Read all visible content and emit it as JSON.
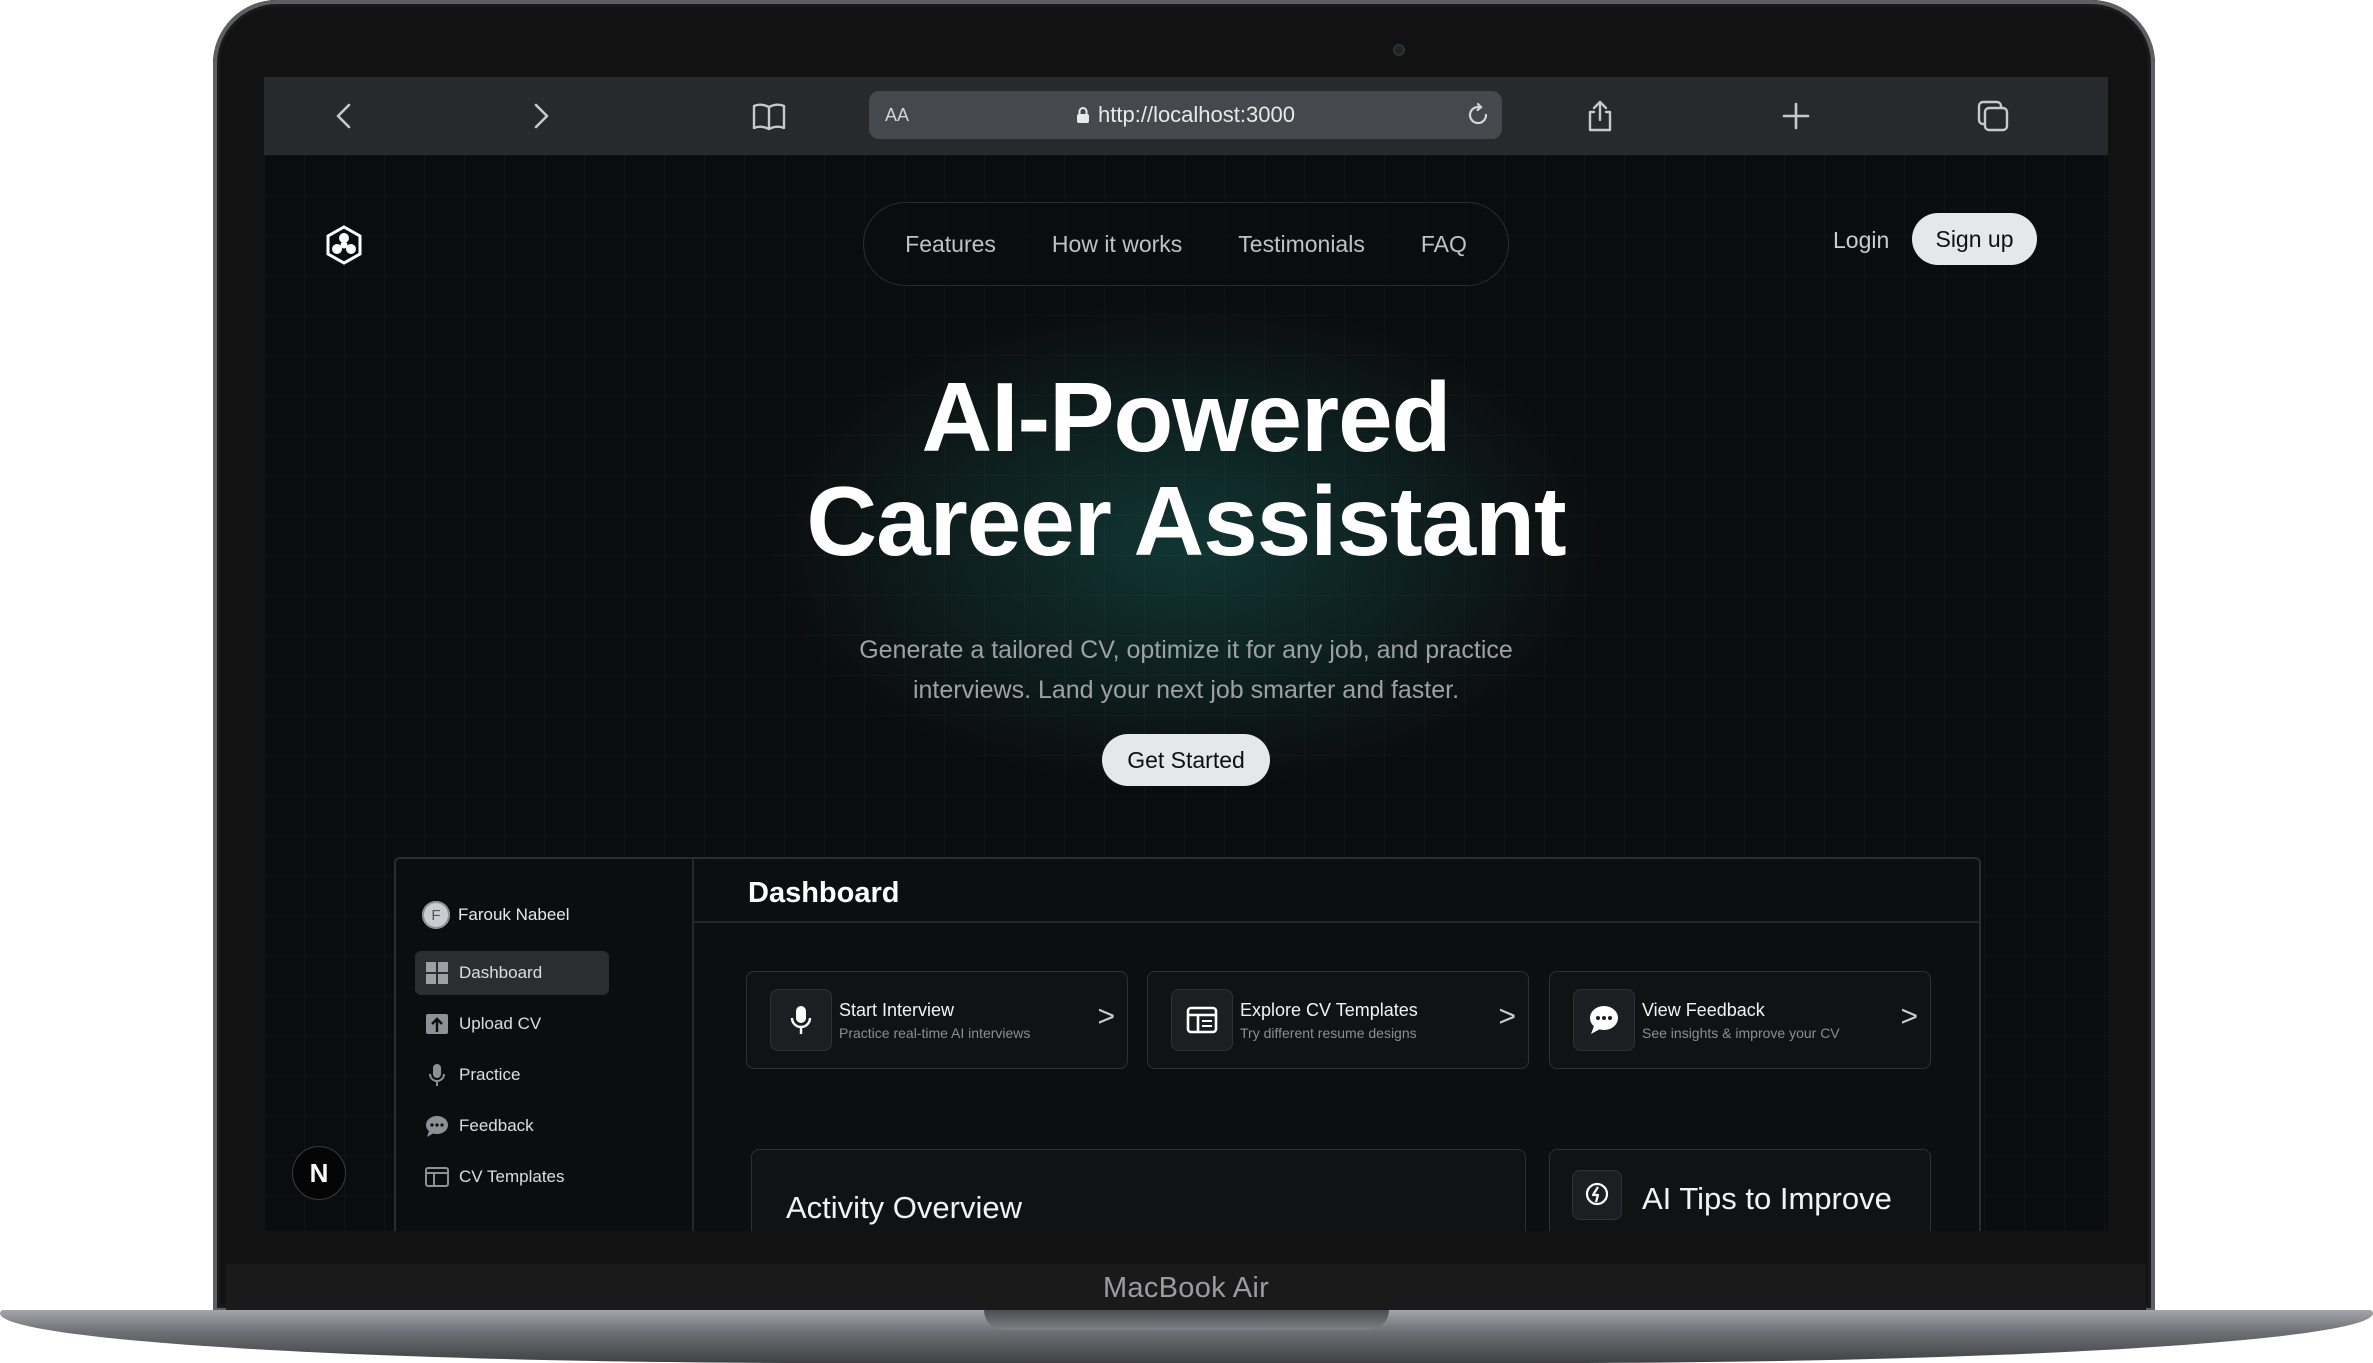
{
  "device": {
    "label": "MacBook Air"
  },
  "browser": {
    "url_aa": "AA",
    "url": "http://localhost:3000",
    "icons": [
      "back-icon",
      "forward-icon",
      "bookmarks-icon",
      "lock-icon",
      "reload-icon",
      "share-icon",
      "new-tab-icon",
      "tabs-icon"
    ]
  },
  "nav": {
    "links": [
      "Features",
      "How it works",
      "Testimonials",
      "FAQ"
    ],
    "login": "Login",
    "signup": "Sign up"
  },
  "hero": {
    "title_line1": "AI-Powered",
    "title_line2": "Career Assistant",
    "subtitle_line1": "Generate a tailored CV, optimize it for any job, and practice",
    "subtitle_line2": "interviews. Land your next job smarter and faster.",
    "cta": "Get Started"
  },
  "dashboard": {
    "user": {
      "initial": "F",
      "name": "Farouk Nabeel"
    },
    "sidebar": [
      {
        "label": "Dashboard",
        "icon": "grid-icon",
        "active": true
      },
      {
        "label": "Upload CV",
        "icon": "upload-icon",
        "active": false
      },
      {
        "label": "Practice",
        "icon": "microphone-icon",
        "active": false
      },
      {
        "label": "Feedback",
        "icon": "chat-bubble-icon",
        "active": false
      },
      {
        "label": "CV Templates",
        "icon": "template-icon",
        "active": false
      }
    ],
    "title": "Dashboard",
    "cards": [
      {
        "title": "Start Interview",
        "desc": "Practice real-time AI interviews",
        "arrow": ">"
      },
      {
        "title": "Explore CV Templates",
        "desc": "Try different resume designs",
        "arrow": ">"
      },
      {
        "title": "View Feedback",
        "desc": "See insights & improve your CV",
        "arrow": ">"
      }
    ],
    "activity_title": "Activity Overview",
    "tips_title": "AI Tips to Improve"
  },
  "dev_badge": "N",
  "colors": {
    "accent_glow": "#155854",
    "page_bg": "#0b0c0d",
    "button_bg": "#e6e7e8"
  }
}
